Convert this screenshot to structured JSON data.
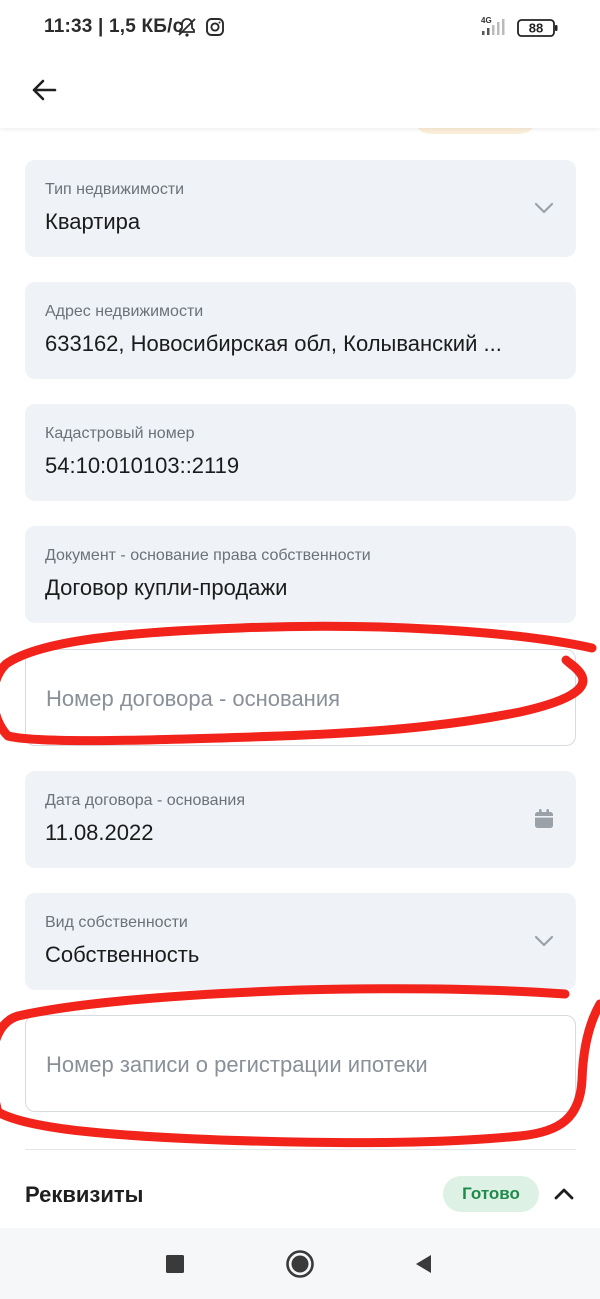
{
  "status_bar": {
    "text": "11:33 | 1,5 КБ/с",
    "network": "4G",
    "battery": "88",
    "icons": [
      "mute-bell-icon",
      "instagram-icon",
      "signal-icon",
      "battery-icon"
    ]
  },
  "top_bar": {
    "back_icon": "arrow-left-icon"
  },
  "fields": [
    {
      "label": "Тип недвижимости",
      "value": "Квартира",
      "icon": "chevron-down-icon"
    },
    {
      "label": "Адрес недвижимости",
      "value": "633162, Новосибирская обл, Колыванский ..."
    },
    {
      "label": "Кадастровый номер",
      "value": "54:10:010103::2119"
    },
    {
      "label": "Документ - основание права собственности",
      "value": "Договор купли-продажи"
    },
    {
      "placeholder": "Номер договора - основания",
      "empty": true
    },
    {
      "label": "Дата договора - основания",
      "value": "11.08.2022",
      "icon": "calendar-icon"
    },
    {
      "label": "Вид собственности",
      "value": "Собственность",
      "icon": "chevron-down-icon"
    },
    {
      "placeholder": "Номер записи о регистрации ипотеки",
      "empty": true
    }
  ],
  "section": {
    "title": "Реквизиты",
    "status": "Готово",
    "icon": "chevron-up-icon"
  },
  "colors": {
    "field_bg": "#eff3f7",
    "accent_green": "#1f8a4c",
    "ready_badge_bg": "#ddf1e4",
    "annotation_red": "#f2231a"
  },
  "nav_bar": {
    "icons": [
      "recents-square-icon",
      "home-circle-icon",
      "back-triangle-icon"
    ]
  }
}
